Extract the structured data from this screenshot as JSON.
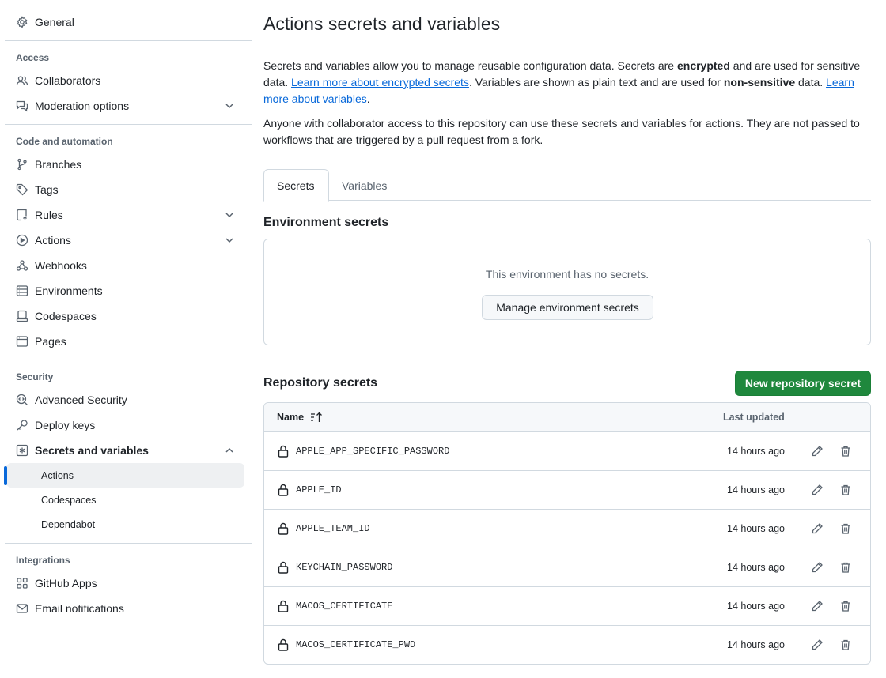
{
  "sidebar": {
    "general": "General",
    "sections": {
      "access": {
        "title": "Access",
        "items": [
          "Collaborators",
          "Moderation options"
        ]
      },
      "code": {
        "title": "Code and automation",
        "items": [
          "Branches",
          "Tags",
          "Rules",
          "Actions",
          "Webhooks",
          "Environments",
          "Codespaces",
          "Pages"
        ]
      },
      "security": {
        "title": "Security",
        "items": [
          "Advanced Security",
          "Deploy keys",
          "Secrets and variables"
        ],
        "subitems": [
          "Actions",
          "Codespaces",
          "Dependabot"
        ],
        "active_subitem": "Actions"
      },
      "integrations": {
        "title": "Integrations",
        "items": [
          "GitHub Apps",
          "Email notifications"
        ]
      }
    }
  },
  "main": {
    "title": "Actions secrets and variables",
    "desc": {
      "p1_a": "Secrets and variables allow you to manage reusable configuration data. Secrets are ",
      "p1_b": "encrypted",
      "p1_c": " and are used for sensitive data. ",
      "link1": "Learn more about encrypted secrets",
      "p1_d": ". Variables are shown as plain text and are used for ",
      "p1_e": "non-sensitive",
      "p1_f": " data. ",
      "link2": "Learn more about variables",
      "p1_g": ".",
      "p2": "Anyone with collaborator access to this repository can use these secrets and variables for actions. They are not passed to workflows that are triggered by a pull request from a fork."
    },
    "tabs": [
      "Secrets",
      "Variables"
    ],
    "selected_tab": "Secrets",
    "environment": {
      "heading": "Environment secrets",
      "empty_message": "This environment has no secrets.",
      "button": "Manage environment secrets"
    },
    "repository": {
      "heading": "Repository secrets",
      "new_button": "New repository secret",
      "columns": {
        "name": "Name",
        "updated": "Last updated"
      },
      "rows": [
        {
          "name": "APPLE_APP_SPECIFIC_PASSWORD",
          "updated": "14 hours ago"
        },
        {
          "name": "APPLE_ID",
          "updated": "14 hours ago"
        },
        {
          "name": "APPLE_TEAM_ID",
          "updated": "14 hours ago"
        },
        {
          "name": "KEYCHAIN_PASSWORD",
          "updated": "14 hours ago"
        },
        {
          "name": "MACOS_CERTIFICATE",
          "updated": "14 hours ago"
        },
        {
          "name": "MACOS_CERTIFICATE_PWD",
          "updated": "14 hours ago"
        }
      ]
    }
  },
  "colors": {
    "primary_button": "#1f883d",
    "link": "#0969da",
    "active_indicator": "#0969da"
  }
}
